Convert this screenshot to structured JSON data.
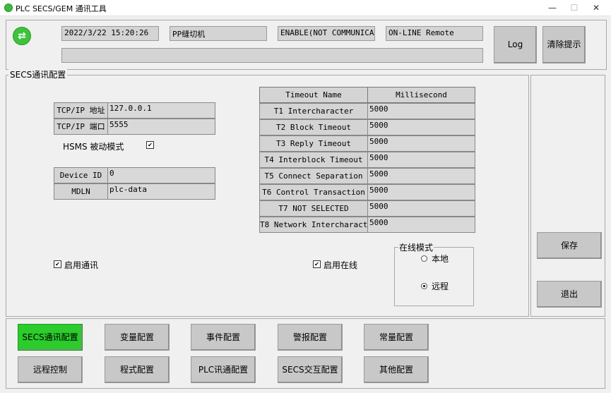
{
  "window": {
    "title": "PLC SECS/GEM 通讯工具",
    "min": "—",
    "max": "☐",
    "close": "✕"
  },
  "status": {
    "datetime": "2022/3/22 15:20:26",
    "machine": "PP缝切机",
    "comm_state": "ENABLE(NOT COMMUNICATI",
    "online_state": "ON-LINE Remote",
    "message": "",
    "log_label": "Log",
    "clear_label": "清除提示"
  },
  "secs": {
    "legend": "SECS通讯配置",
    "tcp_ip_label": "TCP/IP 地址",
    "tcp_ip_value": "127.0.0.1",
    "tcp_port_label": "TCP/IP 端口",
    "tcp_port_value": "5555",
    "hsms_label": "HSMS 被动模式",
    "hsms_checked": true,
    "device_id_label": "Device ID",
    "device_id_value": "0",
    "mdln_label": "MDLN",
    "mdln_value": "plc-data",
    "enable_comm_label": "启用通讯",
    "enable_comm_checked": true,
    "enable_online_label": "启用在线",
    "enable_online_checked": true,
    "online_mode_legend": "在线模式",
    "mode_local": "本地",
    "mode_remote": "远程",
    "mode_selected": "远程"
  },
  "timeouts": {
    "header_name": "Timeout Name",
    "header_value": "Millisecond",
    "rows": [
      {
        "name": "T1 Intercharacter",
        "value": "5000"
      },
      {
        "name": "T2 Block Timeout",
        "value": "5000"
      },
      {
        "name": "T3 Reply Timeout",
        "value": "5000"
      },
      {
        "name": "T4 Interblock Timeout",
        "value": "5000"
      },
      {
        "name": "T5 Connect Separation",
        "value": "5000"
      },
      {
        "name": "T6 Control Transaction",
        "value": "5000"
      },
      {
        "name": "T7 NOT SELECTED",
        "value": "5000"
      },
      {
        "name": "T8 Network Intercharact",
        "value": "5000"
      }
    ]
  },
  "side": {
    "save": "保存",
    "exit": "退出"
  },
  "nav": {
    "row1": [
      "SECS通讯配置",
      "变量配置",
      "事件配置",
      "警报配置",
      "常量配置"
    ],
    "row2": [
      "远程控制",
      "程式配置",
      "PLC讯通配置",
      "SECS交互配置",
      "其他配置"
    ],
    "active": "SECS通讯配置"
  },
  "colors": {
    "active_green": "#2bcc2b",
    "field_gray": "#d4d4d4",
    "button_gray": "#c8c8c8"
  }
}
